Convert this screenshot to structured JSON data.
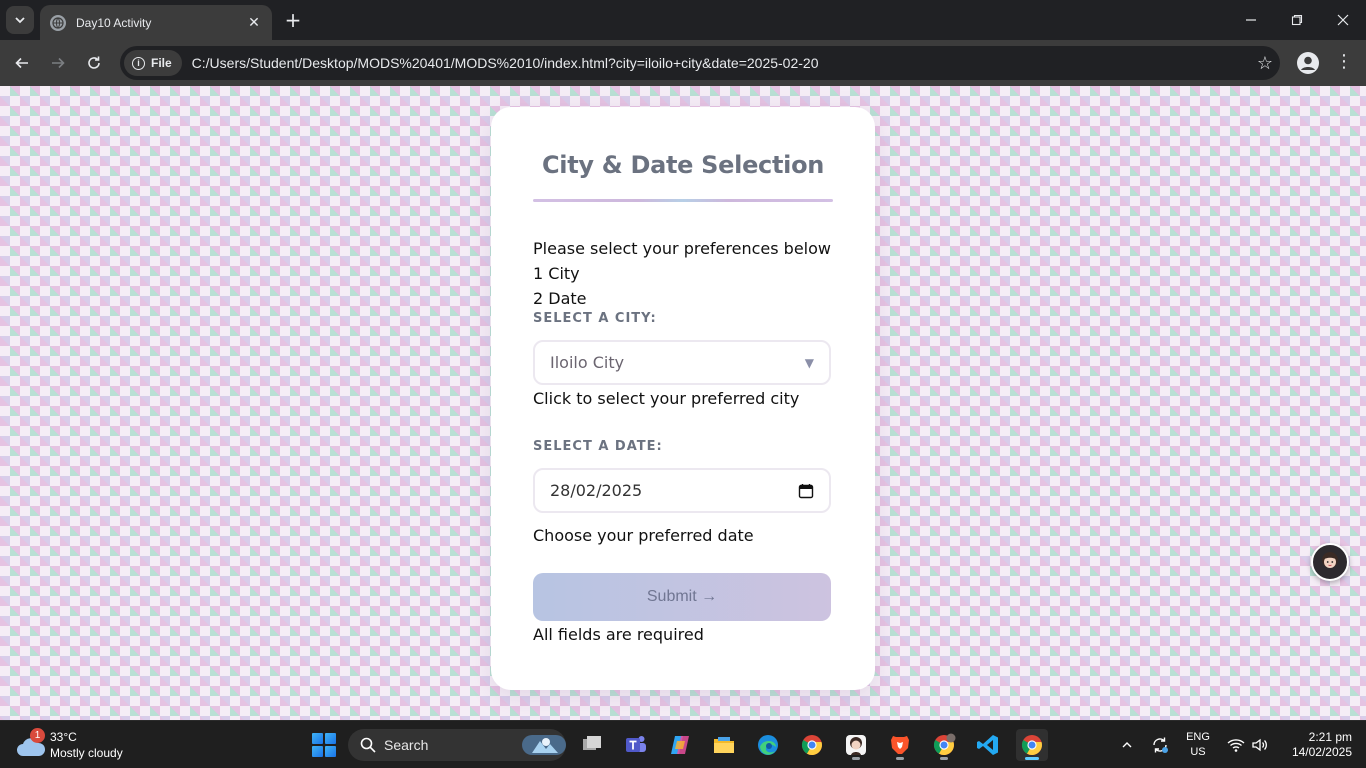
{
  "browser": {
    "tab_title": "Day10 Activity",
    "new_tab_symbol": "+",
    "site_chip": "File",
    "url": "C:/Users/Student/Desktop/MODS%20401/MODS%2010/index.html?city=iloilo+city&date=2025-02-20"
  },
  "page": {
    "title": "City & Date Selection",
    "intro_lines": [
      "Please select your preferences below",
      "1 City",
      "2 Date"
    ],
    "city": {
      "label": "Select a City:",
      "selected": "Iloilo City",
      "hint": "Click to select your preferred city"
    },
    "date": {
      "label": "Select a Date:",
      "value": "28/02/2025",
      "hint": "Choose your preferred date"
    },
    "submit_label": "Submit →",
    "required_note": "All fields are required"
  },
  "taskbar": {
    "weather_badge": "1",
    "weather_temp": "33°C",
    "weather_desc": "Mostly cloudy",
    "search_label": "Search",
    "language_line1": "ENG",
    "language_line2": "US",
    "time": "2:21 pm",
    "date": "14/02/2025"
  },
  "colors": {
    "title_text": "#6b7280",
    "submit_gradient_start": "#b7c4e2",
    "submit_gradient_end": "#cdc3e0",
    "pattern_pink": "#e5c3e2",
    "pattern_mint": "#b9e0d4",
    "pattern_lavender": "#d8cdea"
  }
}
